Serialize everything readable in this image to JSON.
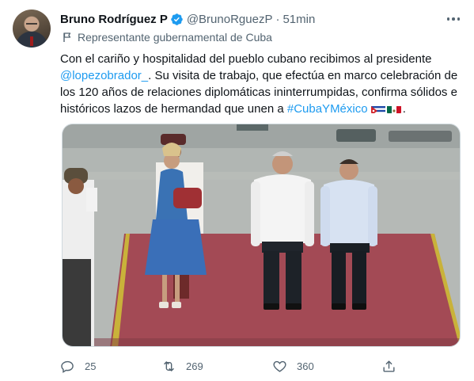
{
  "tweet": {
    "author": {
      "name": "Bruno Rodríguez P",
      "handle": "@BrunoRguezP",
      "separator": "·",
      "time": "51min",
      "label": "Representante gubernamental de Cuba"
    },
    "text": {
      "part1": "Con el cariño y hospitalidad del pueblo cubano recibimos al presidente ",
      "mention": "@lopezobrador_",
      "part2": ". Su visita de trabajo, que efectúa en marco celebración de los 120 años de relaciones diplomáticas ininterrumpidas, confirma sólidos e históricos lazos de hermandad que unen a ",
      "hashtag": "#CubaYMéxico",
      "end": "."
    },
    "metrics": {
      "replies": "25",
      "retweets": "269",
      "likes": "360"
    },
    "icons": [
      "verified-badge-icon",
      "more-options-icon",
      "label-flag-icon",
      "cuba-flag-emoji",
      "mexico-flag-emoji",
      "reply-icon",
      "retweet-icon",
      "like-icon",
      "share-icon"
    ]
  },
  "colors": {
    "link": "#1d9bf0",
    "text_primary": "#0f1419",
    "text_secondary": "#536471",
    "border": "#cfd9de",
    "carpet": "#a34a55"
  }
}
